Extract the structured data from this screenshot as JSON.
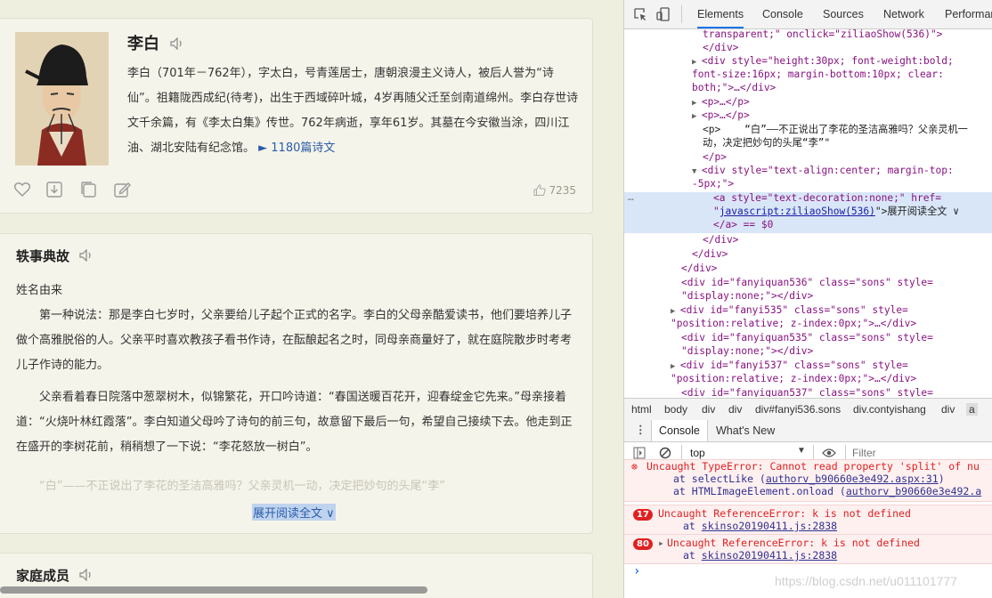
{
  "author": {
    "name": "李白",
    "bio": "李白（701年－762年），字太白，号青莲居士，唐朝浪漫主义诗人，被后人誉为“诗仙”。祖籍陇西成纪(待考)，出生于西域碎叶城，4岁再随父迁至剑南道绵州。李白存世诗文千余篇，有《李太白集》传世。762年病逝，享年61岁。其墓在今安徽当涂，四川江油、湖北安陆有纪念馆。",
    "poems_link": "► 1180篇诗文",
    "likes": "7235",
    "action_icons": [
      "heart-icon",
      "download-icon",
      "copy-icon",
      "edit-icon"
    ]
  },
  "story": {
    "title": "轶事典故",
    "subtitle": "姓名由来",
    "para1": "第一种说法：那是李白七岁时，父亲要给儿子起个正式的名字。李白的父母亲酷爱读书，他们要培养儿子做个高雅脱俗的人。父亲平时喜欢教孩子看书作诗，在酝酿起名之时，同母亲商量好了，就在庭院散步时考考儿子作诗的能力。",
    "para2": "父亲看着春日院落中葱翠树木，似锦繁花，开口吟诗道：“春国送暖百花开，迎春绽金它先来。”母亲接着道：“火烧叶林红霞落”。李白知道父母吟了诗句的前三句，故意留下最后一句，希望自己接续下去。他走到正在盛开的李树花前，稍稍想了一下说：“李花怒放一树白”。",
    "para3": "“白”——不正说出了李花的圣洁高雅吗？父亲灵机一动，决定把妙句的头尾“李”",
    "expand": "展开阅读全文 ∨"
  },
  "family": {
    "title": "家庭成员"
  },
  "devtools": {
    "tabs": [
      "Elements",
      "Console",
      "Sources",
      "Network",
      "Performan"
    ],
    "active_tab": "Elements",
    "elements": {
      "l1": "transparent;\" onclick=\"ziliaoShow(536)\">",
      "l2": "</div>",
      "l3a": "<div style=\"height:30px; font-weight:bold;",
      "l3b": "font-size:16px; margin-bottom:10px; clear:",
      "l3c": "both;\">…</div>",
      "l4": "<p>…</p>",
      "l5": "<p>…</p>",
      "l6a": "<p>    “白”——不正说出了李花的圣洁高雅吗？父亲灵机一",
      "l6b": "动，决定把妙句的头尾“李”\"",
      "l6c": "</p>",
      "l7a": "<div style=\"text-align:center; margin-top:",
      "l7b": "-5px;\">",
      "sel_a": "<a style=\"text-decoration:none;\" href=",
      "sel_b_pre": "\"",
      "sel_b_link": "javascript:ziliaoShow(536)",
      "sel_b_post": "\">展开阅读全文 ∨",
      "sel_c": "</a> == $0",
      "l8": "</div>",
      "l9": "</div>",
      "l10": "</div>",
      "l11a": "<div id=\"fanyiquan536\" class=\"sons\" style=",
      "l11b": "\"display:none;\"></div>",
      "l12a": "<div id=\"fanyi535\" class=\"sons\" style=",
      "l12b": "\"position:relative; z-index:0px;\">…</div>",
      "l13a": "<div id=\"fanyiquan535\" class=\"sons\" style=",
      "l13b": "\"display:none;\"></div>",
      "l14a": "<div id=\"fanyi537\" class=\"sons\" style=",
      "l14b": "\"position:relative; z-index:0px;\">…</div>",
      "l15": "<div id=\"fanyiquan537\" class=\"sons\" style="
    },
    "breadcrumb": [
      "html",
      "body",
      "div",
      "div",
      "div#fanyi536.sons",
      "div.contyishang",
      "div",
      "a"
    ],
    "drawer_tabs": [
      "Console",
      "What's New"
    ],
    "context": "top",
    "filter_placeholder": "Filter",
    "errors": [
      {
        "l1": "Uncaught TypeError: Cannot read property 'split' of nu",
        "l2_pre": "at selectLike (",
        "l2_loc": "authorv_b90660e3e492.aspx:31",
        "l2_post": ")",
        "l3_pre": "at HTMLImageElement.onload (",
        "l3_loc": "authorv_b90660e3e492.a"
      },
      {
        "count": "17",
        "l1": "Uncaught ReferenceError: k is not defined",
        "l2_pre": "at ",
        "l2_loc": "skinso20190411.js:2838"
      },
      {
        "count": "80",
        "l1": "Uncaught ReferenceError: k is not defined",
        "l2_pre": "at ",
        "l2_loc": "skinso20190411.js:2838"
      }
    ],
    "prompt": "›"
  },
  "watermark": "https://blog.csdn.net/u011101777"
}
